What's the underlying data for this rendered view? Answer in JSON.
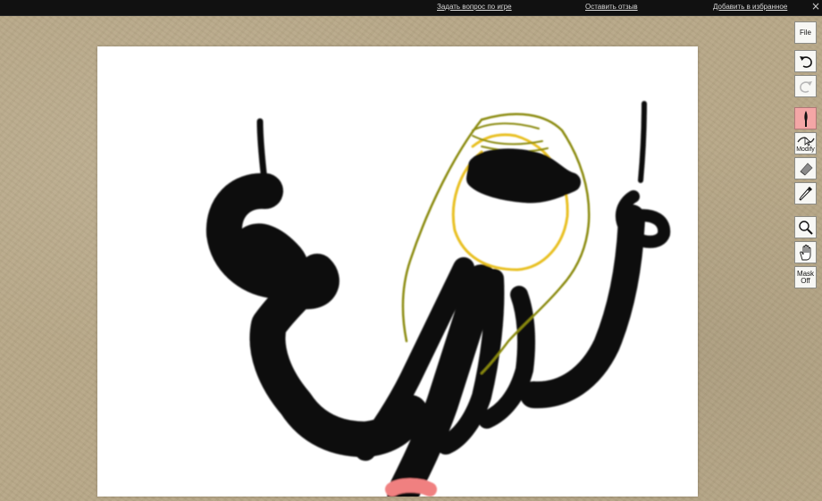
{
  "top_bar": {
    "links": [
      "Задать вопрос по игре",
      "Оставить отзыв",
      "Добавить в избранное"
    ],
    "close_glyph": "×"
  },
  "toolbar": {
    "file_label": "File",
    "modify_label": "Modify",
    "mask_label": "Mask Off",
    "active_tool": "brush"
  },
  "colors": {
    "accent_active_tool": "#f4a6a6",
    "background": "#b8a888",
    "stroke_black": "#0b0b0b",
    "stroke_olive": "#8a8a10",
    "stroke_yellow": "#e8c020",
    "stroke_pink": "#f08080"
  }
}
